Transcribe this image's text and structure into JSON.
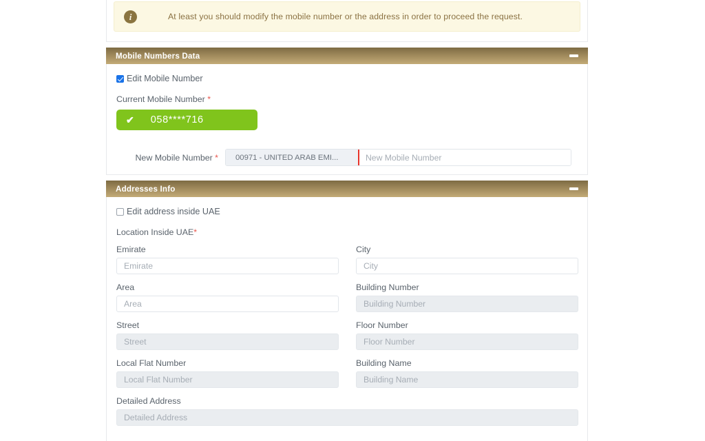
{
  "alert": {
    "icon": "info-circle-icon",
    "message": "At least you should modify the mobile number or the address in order to proceed the request."
  },
  "mobile_section": {
    "title": "Mobile Numbers Data",
    "collapse_icon": "minus-icon",
    "edit_checkbox": {
      "label": "Edit Mobile Number",
      "checked": true
    },
    "current_mobile": {
      "label": "Current Mobile Number ",
      "required_mark": "*",
      "verified_icon": "check-icon",
      "value": "058****716"
    },
    "new_mobile": {
      "label": "New Mobile Number ",
      "required_mark": "*",
      "country_code": "00971 - UNITED ARAB EMI...",
      "placeholder": "New Mobile Number",
      "value": ""
    }
  },
  "addresses_section": {
    "title": "Addresses Info",
    "collapse_icon": "minus-icon",
    "edit_checkbox": {
      "label": "Edit address inside UAE",
      "checked": false
    },
    "location_label": "Location Inside UAE",
    "location_required_mark": "*",
    "fields": [
      {
        "label": "Emirate",
        "placeholder": "Emirate",
        "value": "",
        "disabled": false,
        "column": "left"
      },
      {
        "label": "City",
        "placeholder": "City",
        "value": "",
        "disabled": false,
        "column": "right"
      },
      {
        "label": "Area",
        "placeholder": "Area",
        "value": "",
        "disabled": false,
        "column": "left"
      },
      {
        "label": "Building Number",
        "placeholder": "Building Number",
        "value": "",
        "disabled": true,
        "column": "right"
      },
      {
        "label": "Street",
        "placeholder": "Street",
        "value": "",
        "disabled": true,
        "column": "left"
      },
      {
        "label": "Floor Number",
        "placeholder": "Floor Number",
        "value": "",
        "disabled": true,
        "column": "right"
      },
      {
        "label": "Local Flat Number",
        "placeholder": "Local Flat Number",
        "value": "",
        "disabled": true,
        "column": "left"
      },
      {
        "label": "Building Name",
        "placeholder": "Building Name",
        "value": "",
        "disabled": true,
        "column": "right"
      },
      {
        "label": "Detailed Address",
        "placeholder": "Detailed Address",
        "value": "",
        "disabled": true,
        "column": "full"
      }
    ]
  },
  "colors": {
    "section_header_dark": "#7d6b43",
    "section_header_light": "#c3ab77",
    "alert_bg": "#fcf8e3",
    "alert_text": "#8a7142",
    "green_pill": "#80c41c",
    "required_red": "#e8564d",
    "divider_red": "#e8332a",
    "checkbox_blue": "#1a73e8"
  }
}
